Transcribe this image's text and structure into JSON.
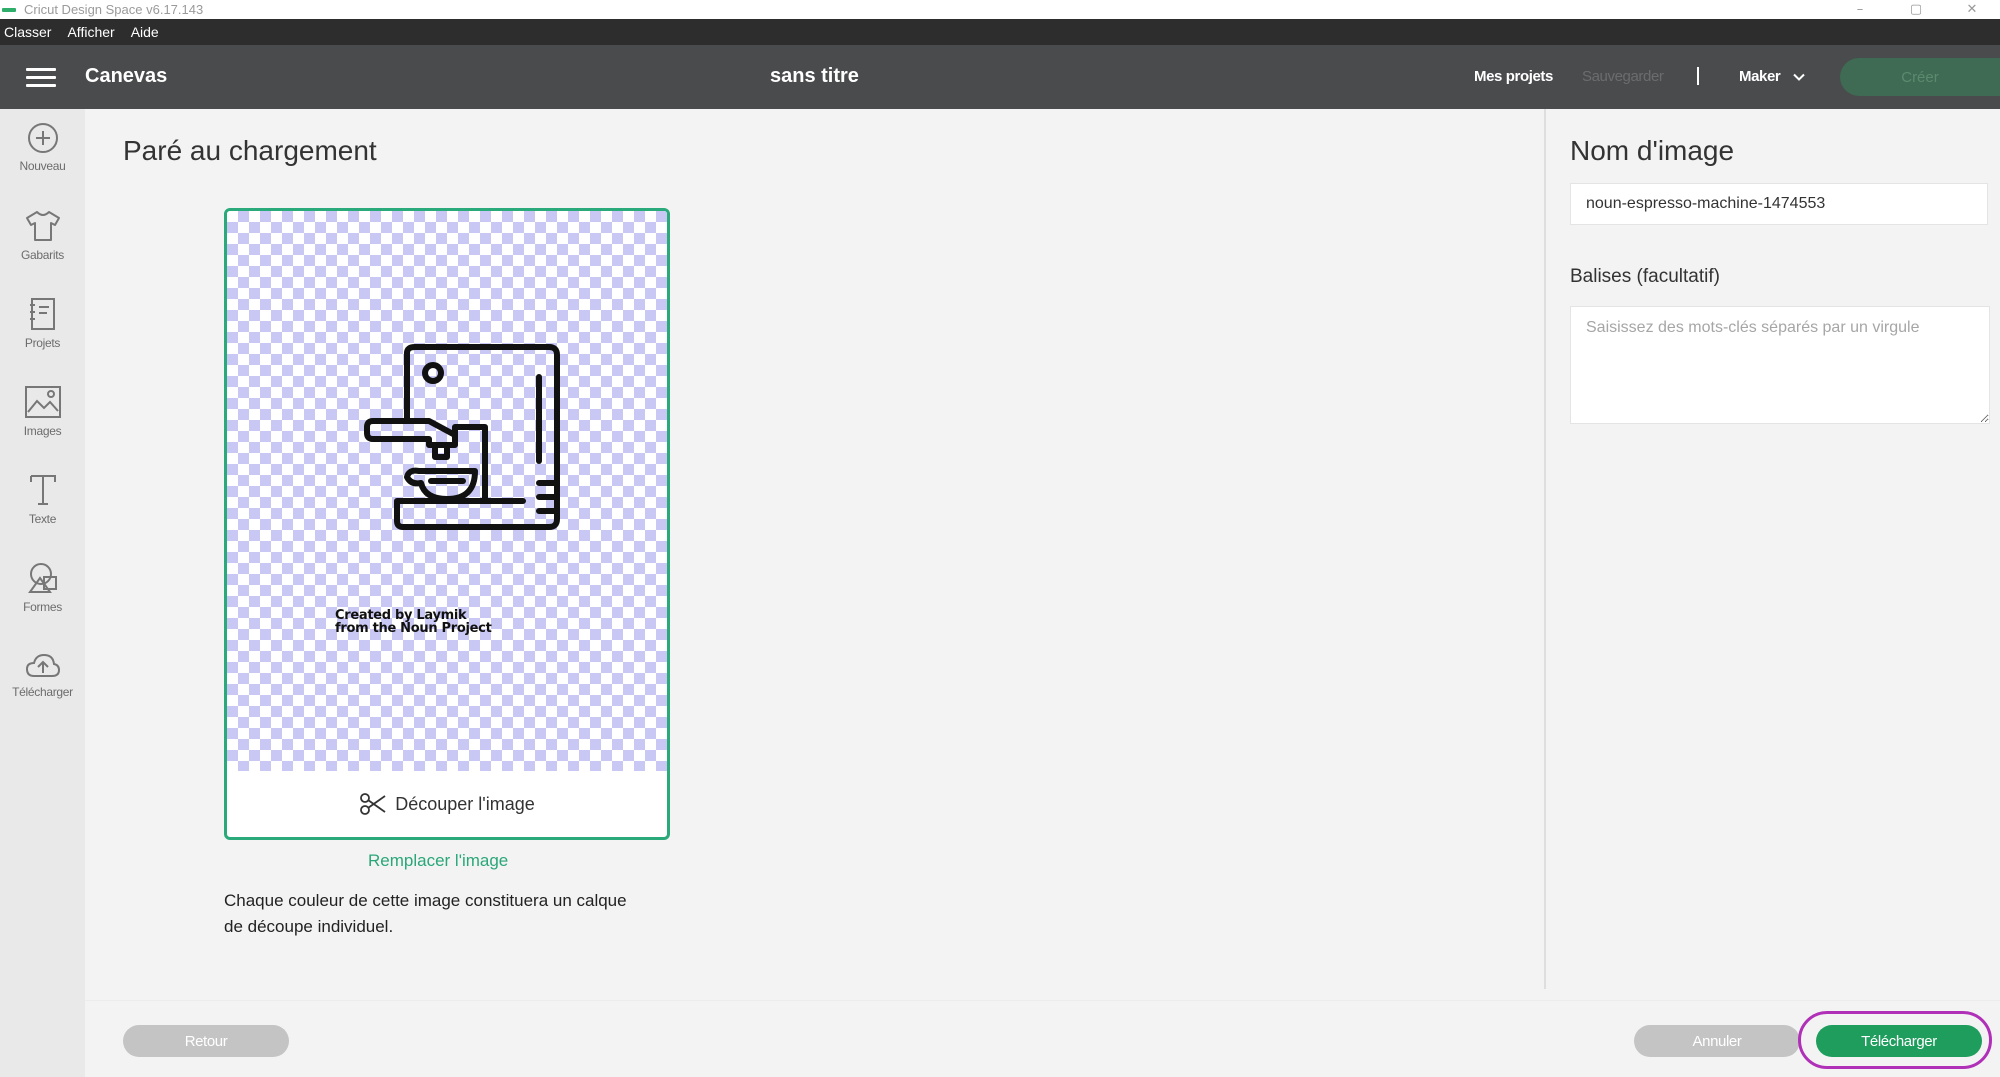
{
  "window": {
    "title": "Cricut Design Space  v6.17.143",
    "controls": [
      "–",
      "▢",
      "✕"
    ]
  },
  "menu": {
    "items": [
      "Classer",
      "Afficher",
      "Aide"
    ]
  },
  "header": {
    "section": "Canevas",
    "doc_title": "sans titre",
    "my_projects": "Mes projets",
    "save": "Sauvegarder",
    "machine": "Maker",
    "make": "Créer"
  },
  "sidebar": {
    "items": [
      {
        "label": "Nouveau",
        "icon": "plus-circle-icon"
      },
      {
        "label": "Gabarits",
        "icon": "tshirt-icon"
      },
      {
        "label": "Projets",
        "icon": "notebook-icon"
      },
      {
        "label": "Images",
        "icon": "image-icon"
      },
      {
        "label": "Texte",
        "icon": "text-icon"
      },
      {
        "label": "Formes",
        "icon": "shapes-icon"
      },
      {
        "label": "Télécharger",
        "icon": "cloud-upload-icon"
      }
    ]
  },
  "main": {
    "title": "Paré au chargement",
    "credit_line1": "Created by Laymik",
    "credit_line2": "from the Noun Project",
    "crop_label": "Découper l'image",
    "replace_label": "Remplacer l'image",
    "info": "Chaque couleur de cette image constituera un calque de découpe individuel."
  },
  "panel": {
    "name_title": "Nom d'image",
    "name_value": "noun-espresso-machine-1474553",
    "tags_label": "Balises (facultatif)",
    "tags_placeholder": "Saisissez des mots-clés séparés par un virgule"
  },
  "footer": {
    "back": "Retour",
    "cancel": "Annuler",
    "upload": "Télécharger"
  },
  "colors": {
    "accent": "#2aaa7b",
    "upload_button": "#1e9d5c",
    "highlight": "#b030b8",
    "header_bg": "#4a4b4d",
    "checker": "#c9c8f4"
  }
}
